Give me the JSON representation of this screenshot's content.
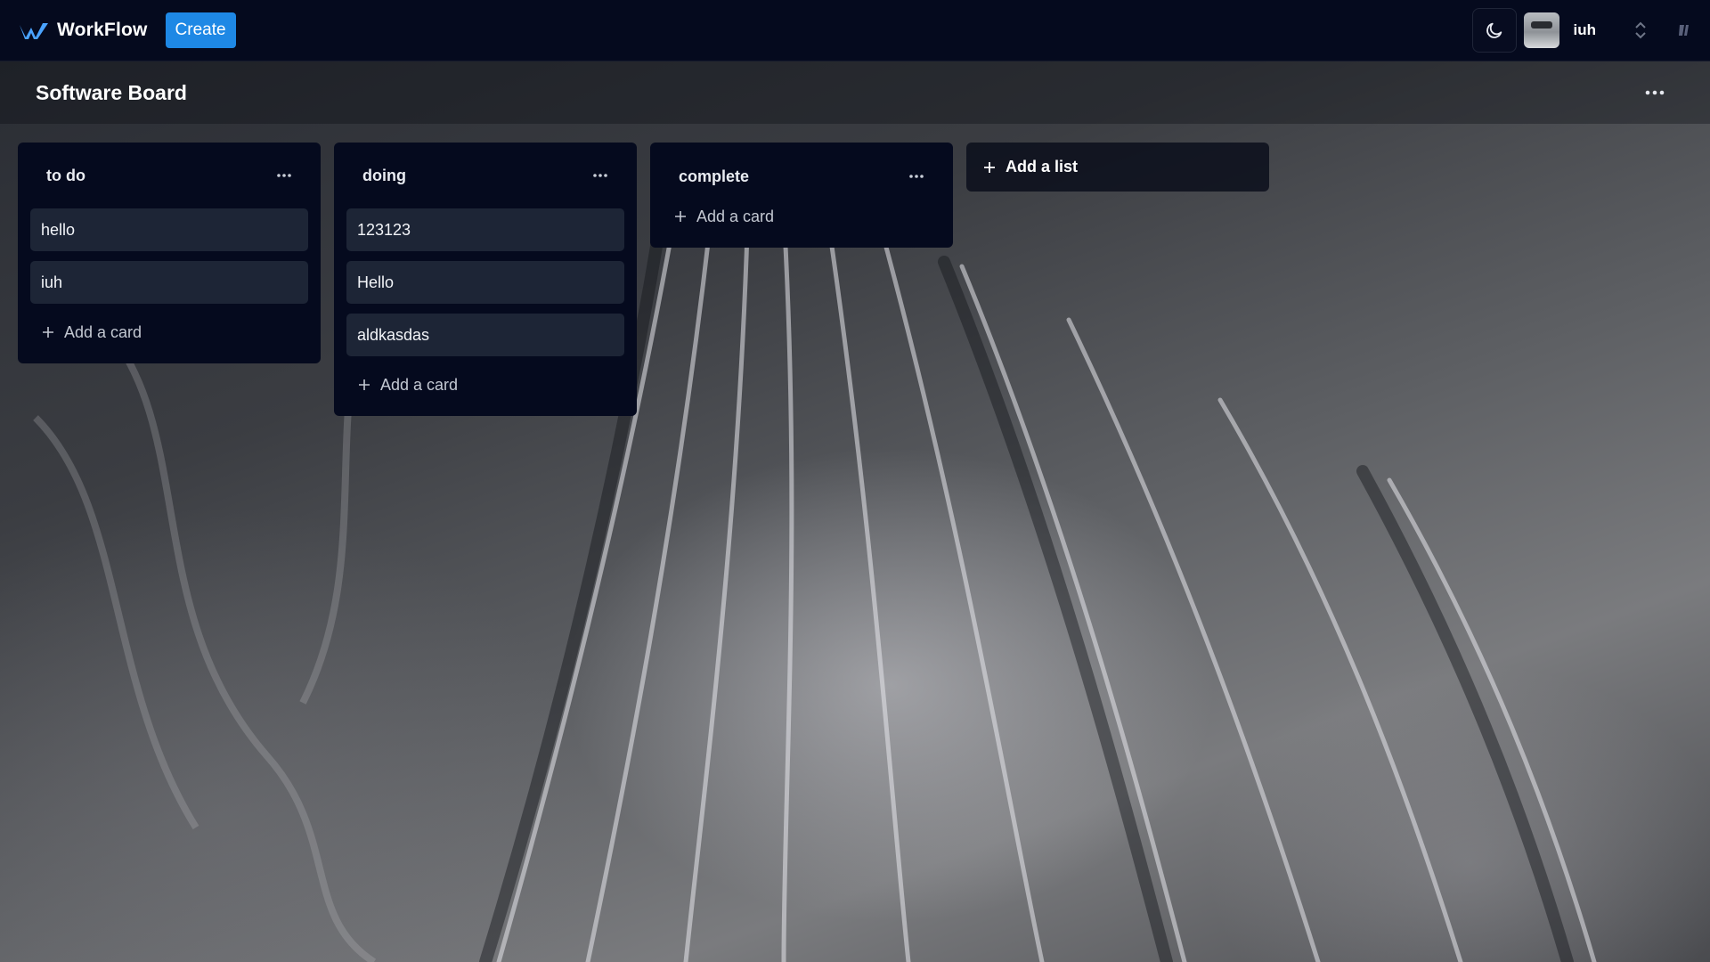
{
  "app": {
    "name": "WorkFlow",
    "create_label": "Create"
  },
  "user": {
    "name": "iuh"
  },
  "board": {
    "title": "Software Board"
  },
  "lists": [
    {
      "title": "to do",
      "cards": [
        "hello",
        "iuh"
      ],
      "add_card_label": "Add a card"
    },
    {
      "title": "doing",
      "cards": [
        "123123",
        "Hello",
        "aldkasdas"
      ],
      "add_card_label": "Add a card"
    },
    {
      "title": "complete",
      "cards": [],
      "add_card_label": "Add a card"
    }
  ],
  "add_list_label": "Add a list",
  "colors": {
    "topbar_bg": "#050a1e",
    "accent": "#1e88e5",
    "list_bg": "#050a1e",
    "card_bg": "#1d2536"
  },
  "icons": {
    "logo": "workflow-logo-icon",
    "theme": "moon-icon",
    "switcher": "chevron-up-down-icon",
    "more": "more-horizontal-icon",
    "add": "plus-icon"
  }
}
